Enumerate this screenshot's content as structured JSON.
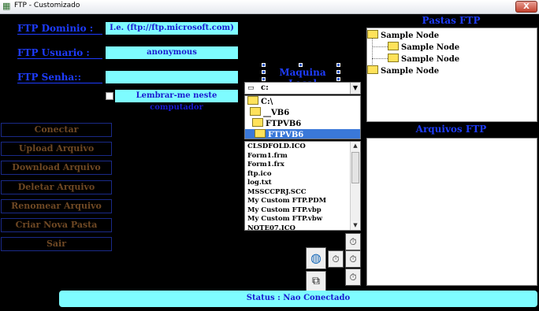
{
  "window": {
    "title": "FTP - Customizado",
    "close_label": "X"
  },
  "form": {
    "domain_label": "FTP Dominio :",
    "domain_value": "I.e. (ftp://ftp.microsoft.com)",
    "user_label": "FTP Usuario :",
    "user_value": "anonymous",
    "password_label": "FTP Senha::",
    "password_value": "",
    "remember_label": "Lembrar-me neste computador"
  },
  "actions": [
    "Conectar",
    "Upload Arquivo",
    "Download Arquivo",
    "Deletar Arquivo",
    "Renomear Arquivo",
    "Criar Nova Pasta",
    "Sair"
  ],
  "local": {
    "title": "Maquina Local",
    "drive": "c:",
    "dirs": [
      {
        "label": "C:\\",
        "selected": false
      },
      {
        "label": "__VB6",
        "selected": false
      },
      {
        "label": "FTPVB6",
        "selected": false
      },
      {
        "label": "FTPVB6",
        "selected": true
      }
    ],
    "files": [
      "CLSDFOLD.ICO",
      "Form1.frm",
      "Form1.frx",
      "ftp.ico",
      "log.txt",
      "MSSCCPRJ.SCC",
      "My Custom FTP.PDM",
      "My Custom FTP.vbp",
      "My Custom FTP.vbw",
      "NOTE07.ICO"
    ]
  },
  "remote": {
    "folders_title": "Pastas FTP",
    "files_title": "Arquivos FTP",
    "tree": [
      "Sample Node",
      "Sample Node",
      "Sample Node",
      "Sample Node"
    ]
  },
  "status": "Status : Nao Conectado",
  "colors": {
    "label_blue": "#1e3cff",
    "field_cyan": "#7efcff",
    "button_brown": "#6e4824",
    "selection": "#3a78d8"
  },
  "icons": {
    "timer": "stopwatch-icon",
    "network": "network-globe-icon",
    "windows": "windows-stack-icon"
  }
}
